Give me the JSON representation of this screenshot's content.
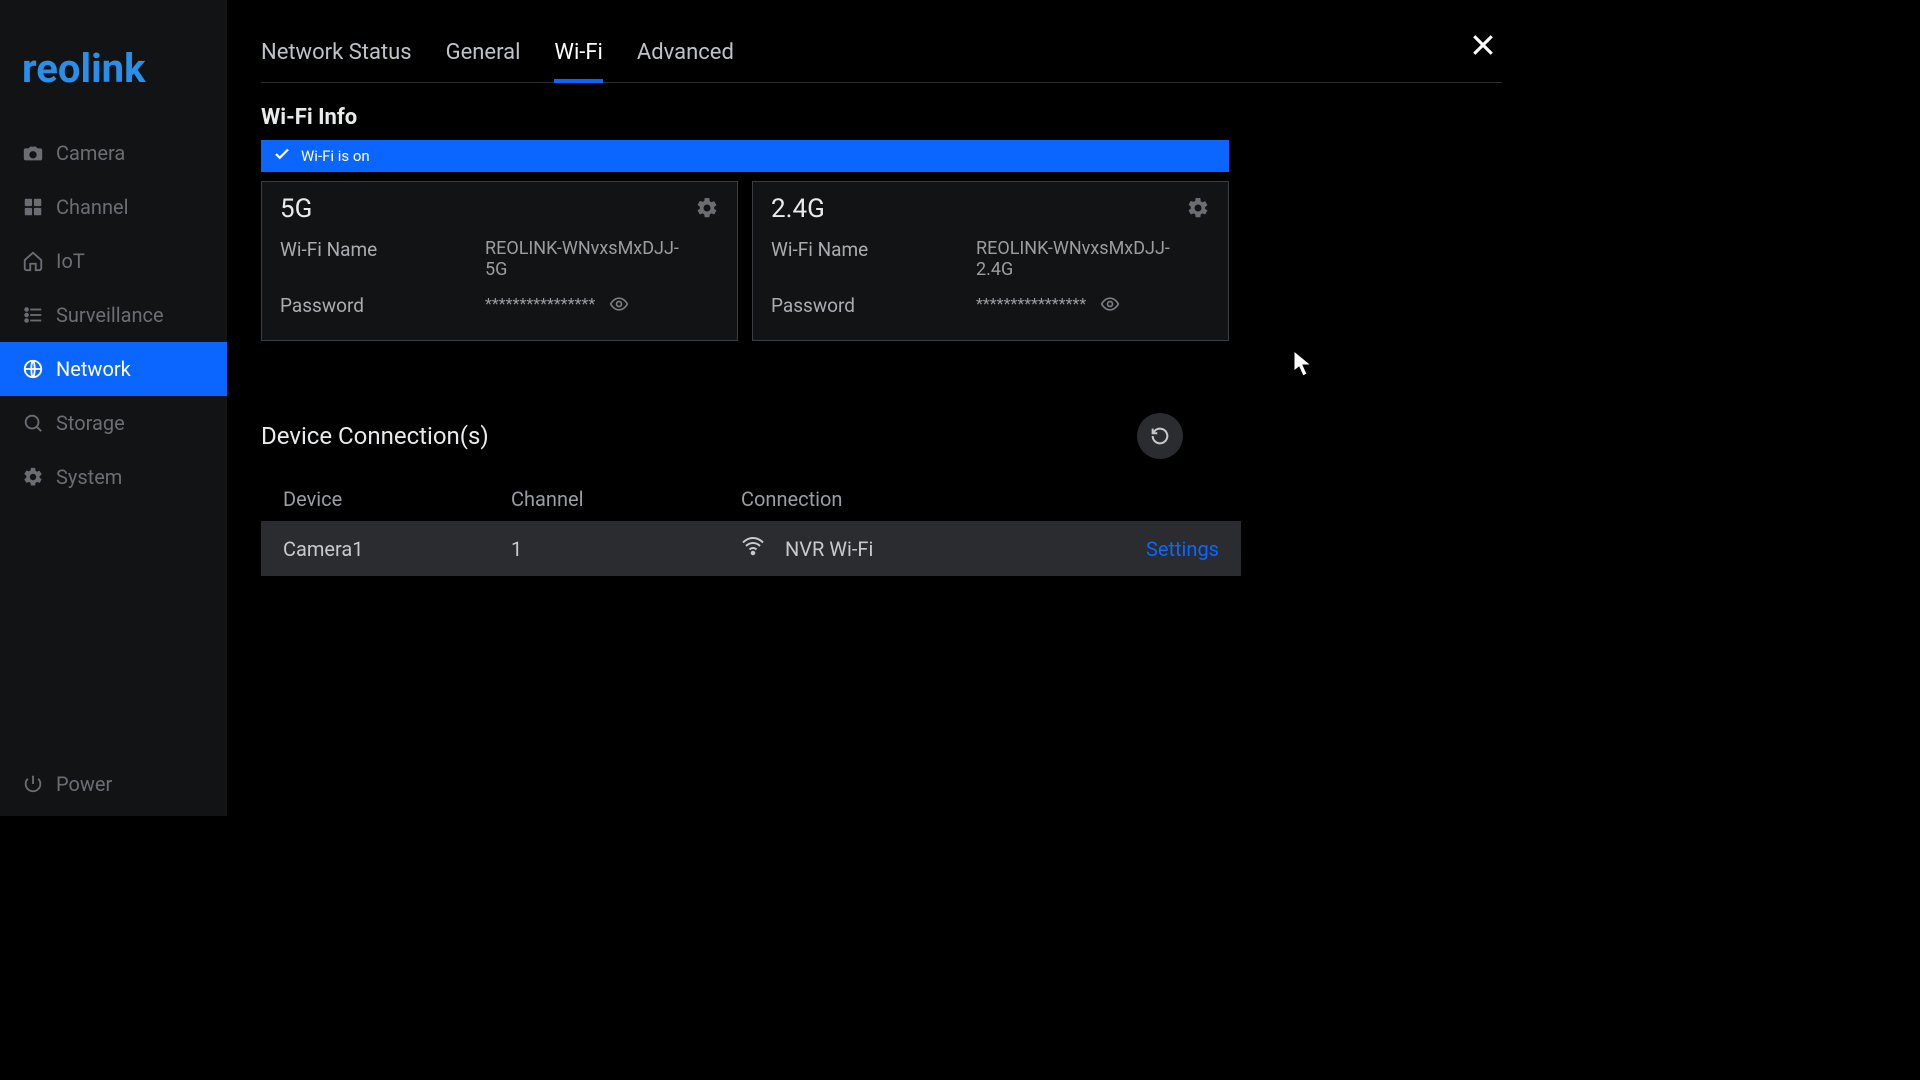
{
  "brand": "reolink",
  "sidebar": {
    "items": [
      {
        "label": "Camera"
      },
      {
        "label": "Channel"
      },
      {
        "label": "IoT"
      },
      {
        "label": "Surveillance"
      },
      {
        "label": "Network"
      },
      {
        "label": "Storage"
      },
      {
        "label": "System"
      }
    ],
    "power": "Power"
  },
  "tabs": [
    {
      "label": "Network Status"
    },
    {
      "label": "General"
    },
    {
      "label": "Wi-Fi"
    },
    {
      "label": "Advanced"
    }
  ],
  "wifi_info": {
    "title": "Wi-Fi Info",
    "status": "Wi-Fi is on",
    "bands": {
      "b5g": {
        "title": "5G",
        "name_label": "Wi-Fi Name",
        "name_value": "REOLINK-WNvxsMxDJJ-5G",
        "password_label": "Password",
        "password_masked": "****************"
      },
      "b24g": {
        "title": "2.4G",
        "name_label": "Wi-Fi Name",
        "name_value": "REOLINK-WNvxsMxDJJ-2.4G",
        "password_label": "Password",
        "password_masked": "****************"
      }
    }
  },
  "devices": {
    "title": "Device Connection(s)",
    "columns": {
      "device": "Device",
      "channel": "Channel",
      "connection": "Connection"
    },
    "rows": [
      {
        "device": "Camera1",
        "channel": "1",
        "connection": "NVR Wi-Fi",
        "action": "Settings"
      }
    ]
  }
}
